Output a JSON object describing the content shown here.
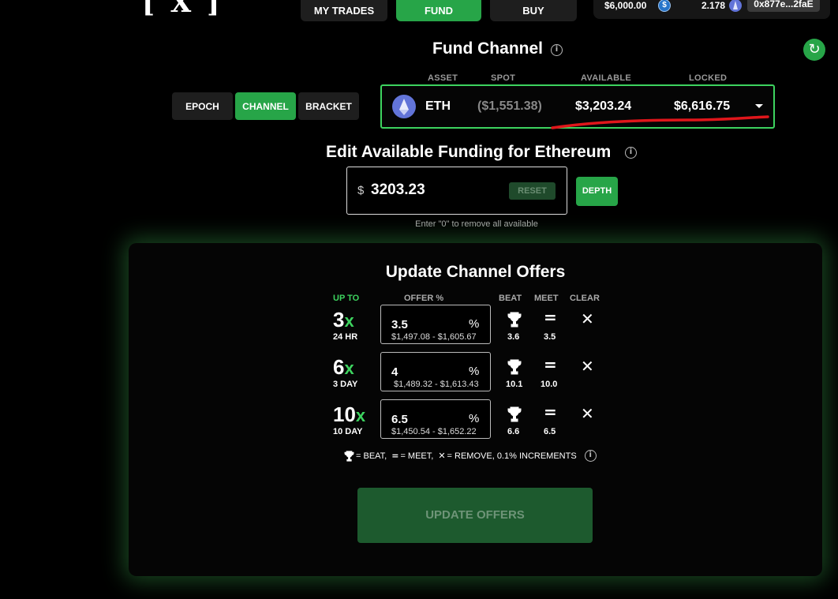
{
  "logo": {
    "text": "[ X ]"
  },
  "nav": {
    "my_trades": "MY TRADES",
    "fund": "FUND",
    "buy": "BUY"
  },
  "wallet": {
    "usd_balance": "$6,000.00",
    "eth_balance": "2.178",
    "address": "0x877e...2faE",
    "usdc_icon_glyph": "$"
  },
  "fund_channel": {
    "title": "Fund Channel",
    "info_glyph": "i",
    "refresh_glyph": "↻"
  },
  "modes": [
    "EPOCH",
    "CHANNEL",
    "BRACKET"
  ],
  "asset_table": {
    "headers": {
      "asset": "ASSET",
      "spot": "SPOT",
      "available": "AVAILABLE",
      "locked": "LOCKED"
    },
    "asset": "ETH",
    "spot": "($1,551.38)",
    "available": "$3,203.24",
    "locked": "$6,616.75"
  },
  "edit_funding": {
    "title": "Edit Available Funding for Ethereum",
    "currency": "$",
    "value": "3203.23",
    "reset_label": "RESET",
    "depth_label": "DEPTH",
    "hint": "Enter \"0\" to remove all available"
  },
  "offers": {
    "title": "Update Channel Offers",
    "headers": {
      "upto": "UP TO",
      "offer": "OFFER %",
      "beat": "BEAT",
      "meet": "MEET",
      "clear": "CLEAR"
    },
    "rows": [
      {
        "mult": "3",
        "x": "x",
        "duration": "24 HR",
        "offer": "3.5",
        "pct": "%",
        "range": "$1,497.08 - $1,605.67",
        "beat": "3.6",
        "meet": "3.5"
      },
      {
        "mult": "6",
        "x": "x",
        "duration": "3 DAY",
        "offer": "4",
        "pct": "%",
        "range": "$1,489.32 - $1,613.43",
        "beat": "10.1",
        "meet": "10.0"
      },
      {
        "mult": "10",
        "x": "x",
        "duration": "10 DAY",
        "offer": "6.5",
        "pct": "%",
        "range": "$1,450.54 - $1,652.22",
        "beat": "6.6",
        "meet": "6.5"
      }
    ],
    "eq_glyph": "=",
    "x_glyph": "✕",
    "legend": {
      "beat": "= BEAT,",
      "meet": "= MEET,",
      "remove": "= REMOVE, 0.1% INCREMENTS"
    },
    "update_label": "UPDATE OFFERS"
  },
  "colors": {
    "accent_green": "#27a548",
    "bright_green": "#3dd35f",
    "annotation_red": "#e0161b"
  }
}
